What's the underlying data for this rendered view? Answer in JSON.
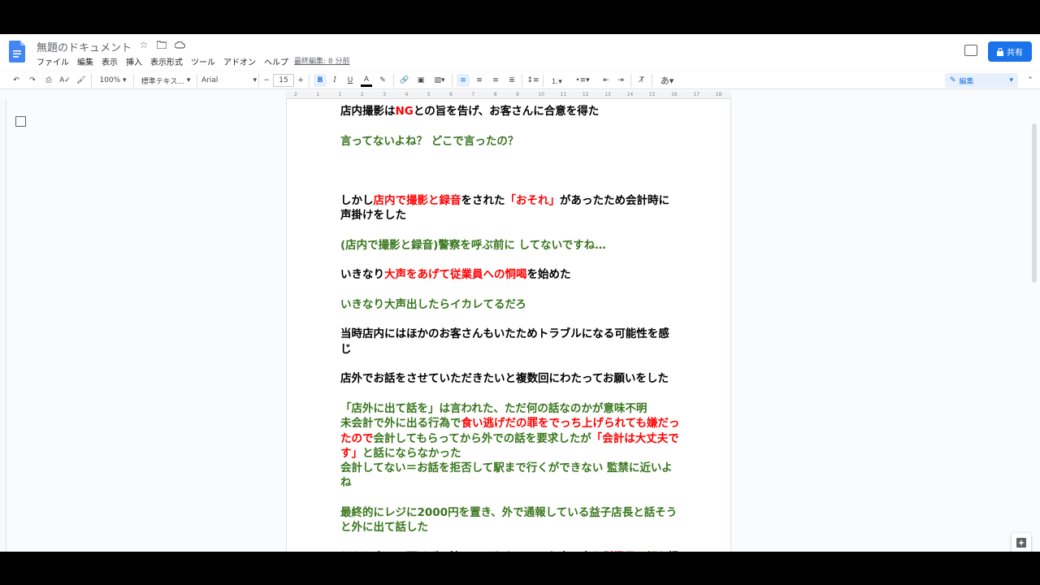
{
  "app": {
    "doc_title": "無題のドキュメント",
    "last_edit": "最終編集: 8 分前",
    "share_label": "共有",
    "mode_label": "編集",
    "brand_color": "#1a73e8"
  },
  "menu": [
    "ファイル",
    "編集",
    "表示",
    "挿入",
    "表示形式",
    "ツール",
    "アドオン",
    "ヘルプ"
  ],
  "toolbar": {
    "zoom": "100%",
    "style": "標準テキス...",
    "font": "Arial",
    "font_size": "15",
    "minus": "−",
    "plus": "+",
    "bold": "B",
    "italic": "I",
    "underline": "U",
    "text_color": "A",
    "input_tool": "あ"
  },
  "ruler_marks": [
    "2",
    "1",
    "1",
    "2",
    "3",
    "4",
    "5",
    "6",
    "7",
    "8",
    "9",
    "10",
    "11",
    "12",
    "13",
    "14",
    "15",
    "16",
    "17",
    "18"
  ],
  "document": {
    "paragraphs": [
      {
        "tight": false,
        "runs": [
          {
            "c": "k",
            "t": "店内撮影は"
          },
          {
            "c": "r",
            "t": "NG"
          },
          {
            "c": "k",
            "t": "との旨を告げ、お客さんに合意を得た"
          }
        ]
      },
      {
        "tight": false,
        "runs": [
          {
            "c": "g",
            "t": "言ってないよね？ どこで言ったの？"
          }
        ]
      },
      {
        "tight": false,
        "runs": [
          {
            "c": "k",
            "t": " "
          }
        ]
      },
      {
        "tight": false,
        "runs": [
          {
            "c": "k",
            "t": "しかし"
          },
          {
            "c": "r",
            "t": "店内で撮影と録音"
          },
          {
            "c": "k",
            "t": "をされた"
          },
          {
            "c": "r",
            "t": "「おそれ」"
          },
          {
            "c": "k",
            "t": "があったため会計時に声掛けをした"
          }
        ]
      },
      {
        "tight": false,
        "runs": [
          {
            "c": "g",
            "t": "(店内で撮影と録音)警察を呼ぶ前に してないですね…"
          }
        ]
      },
      {
        "tight": false,
        "runs": [
          {
            "c": "k",
            "t": "いきなり"
          },
          {
            "c": "r",
            "t": "大声をあげて従業員への恫喝"
          },
          {
            "c": "k",
            "t": "を始めた"
          }
        ]
      },
      {
        "tight": false,
        "runs": [
          {
            "c": "g",
            "t": "いきなり大声出したらイカレてるだろ"
          }
        ]
      },
      {
        "tight": false,
        "runs": [
          {
            "c": "k",
            "t": "当時店内にはほかのお客さんもいたためトラブルになる可能性を感じ"
          }
        ]
      },
      {
        "tight": false,
        "runs": [
          {
            "c": "k",
            "t": "店外でお話をさせていただきたいと複数回にわたってお願いをした"
          }
        ]
      },
      {
        "tight": true,
        "runs": [
          {
            "c": "g",
            "t": "「店外に出て話を」は言われた、ただ何の話なのかが意味不明"
          }
        ]
      },
      {
        "tight": true,
        "runs": [
          {
            "c": "g",
            "t": "未会計で外に出る行為で"
          },
          {
            "c": "r",
            "t": "食い逃げだの罪をでっち上げられても嫌だったので"
          },
          {
            "c": "g",
            "t": "会計してもらってから外での話を要求したが"
          },
          {
            "c": "r",
            "t": "「会計は大丈夫です」"
          },
          {
            "c": "g",
            "t": "と話にならなかった"
          }
        ]
      },
      {
        "tight": false,
        "runs": [
          {
            "c": "g",
            "t": "会計してない＝お話を拒否して駅まで行くができない 監禁に近いよね"
          }
        ]
      },
      {
        "tight": false,
        "runs": [
          {
            "c": "g",
            "t": "最終的にレジに2000円を置き、外で通報している益子店長と話そうと外に出て話した"
          }
        ]
      },
      {
        "tight": true,
        "runs": [
          {
            "c": "k",
            "t": "しかし応じて頂けず、持っていたカメラでお店の中や"
          },
          {
            "c": "r",
            "t": "従業員の顔"
          },
          {
            "c": "k",
            "t": "を撮影・録音を始めた"
          }
        ]
      }
    ]
  }
}
